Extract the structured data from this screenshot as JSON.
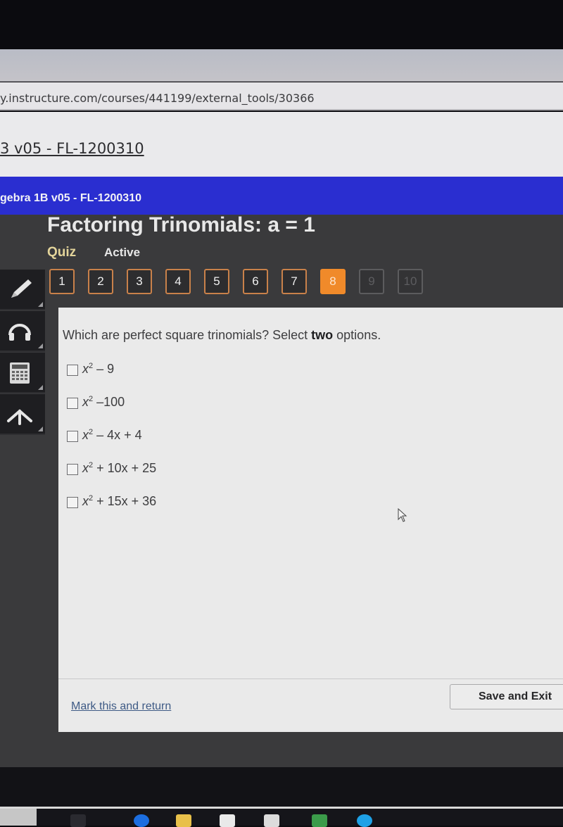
{
  "browser": {
    "url": "y.instructure.com/courses/441199/external_tools/30366"
  },
  "course_header": {
    "breadcrumb_link": "3 v05 - FL-1200310"
  },
  "course_bar": {
    "title": "gebra 1B v05 - FL-1200310"
  },
  "activity": {
    "title": "Factoring Trinomials: a = 1",
    "type": "Quiz",
    "status": "Active"
  },
  "question_nav": {
    "current": 8,
    "items": [
      {
        "label": "1",
        "state": "answered"
      },
      {
        "label": "2",
        "state": "answered"
      },
      {
        "label": "3",
        "state": "answered"
      },
      {
        "label": "4",
        "state": "answered"
      },
      {
        "label": "5",
        "state": "answered"
      },
      {
        "label": "6",
        "state": "answered"
      },
      {
        "label": "7",
        "state": "answered"
      },
      {
        "label": "8",
        "state": "current"
      },
      {
        "label": "9",
        "state": "locked"
      },
      {
        "label": "10",
        "state": "locked"
      }
    ]
  },
  "tools": [
    {
      "name": "pencil-icon"
    },
    {
      "name": "headphones-icon"
    },
    {
      "name": "calculator-icon"
    },
    {
      "name": "collapse-icon"
    }
  ],
  "question": {
    "prompt_before": "Which are perfect square trinomials? Select ",
    "prompt_bold": "two",
    "prompt_after": " options.",
    "options": [
      {
        "var": "x",
        "exp": "2",
        "rest": " – 9",
        "checked": false
      },
      {
        "var": "x",
        "exp": "2",
        "rest": " –100",
        "checked": false
      },
      {
        "var": "x",
        "exp": "2",
        "rest": " – 4x + 4",
        "checked": false
      },
      {
        "var": "x",
        "exp": "2",
        "rest": " + 10x + 25",
        "checked": false
      },
      {
        "var": "x",
        "exp": "2",
        "rest": " + 15x + 36",
        "checked": false
      }
    ]
  },
  "footer": {
    "mark_link": "Mark this and return",
    "save_button": "Save and Exit"
  },
  "colors": {
    "course_bar": "#2a2ed0",
    "current_question": "#f08a2a",
    "answered_border": "#c9814a",
    "quiz_label": "#e3d49a"
  }
}
